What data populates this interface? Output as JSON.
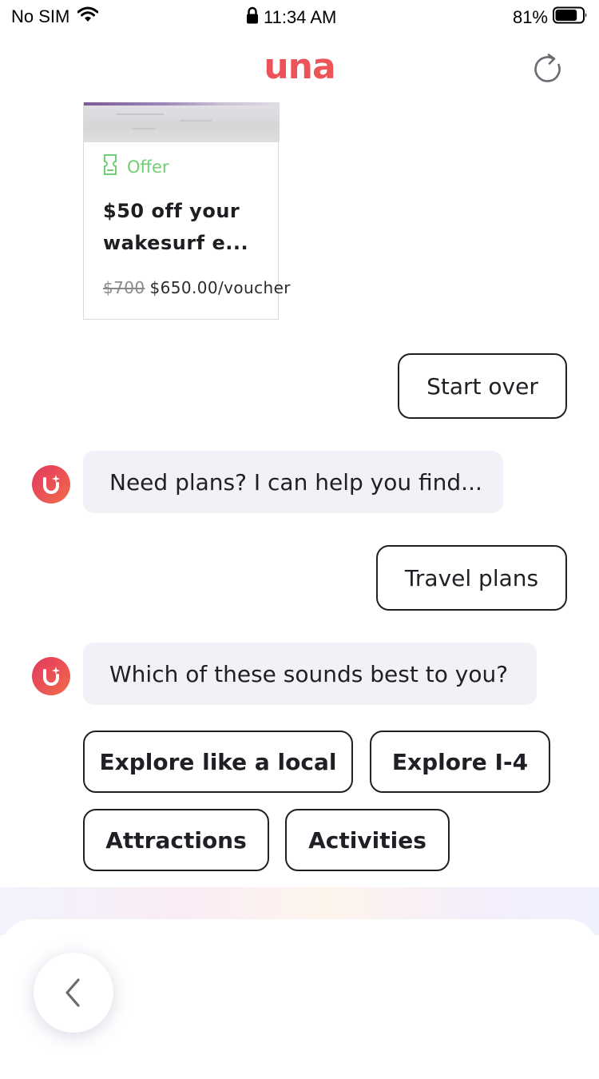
{
  "status_bar": {
    "carrier": "No SIM",
    "time": "11:34 AM",
    "battery": "81%",
    "battery_level": 0.81
  },
  "header": {
    "logo": "una",
    "brand_gradient": [
      "#ea3d68",
      "#f06a4a"
    ],
    "refresh_icon": "refresh-icon"
  },
  "offer_card": {
    "tag": "Offer",
    "title": "$50 off your wakesurf e...",
    "old_price": "$700",
    "price": "$650.00/voucher",
    "tag_color": "#6fcf74"
  },
  "chat": {
    "user_reply_1": "Start over",
    "bot_message_1": "Need plans? I can help you find...",
    "user_reply_2": "Travel plans",
    "bot_message_2": "Which of these sounds best to you?",
    "options": [
      "Explore like a local",
      "Explore I-4",
      "Attractions",
      "Activities"
    ]
  },
  "bottom": {
    "back_icon": "chevron-left-icon"
  }
}
